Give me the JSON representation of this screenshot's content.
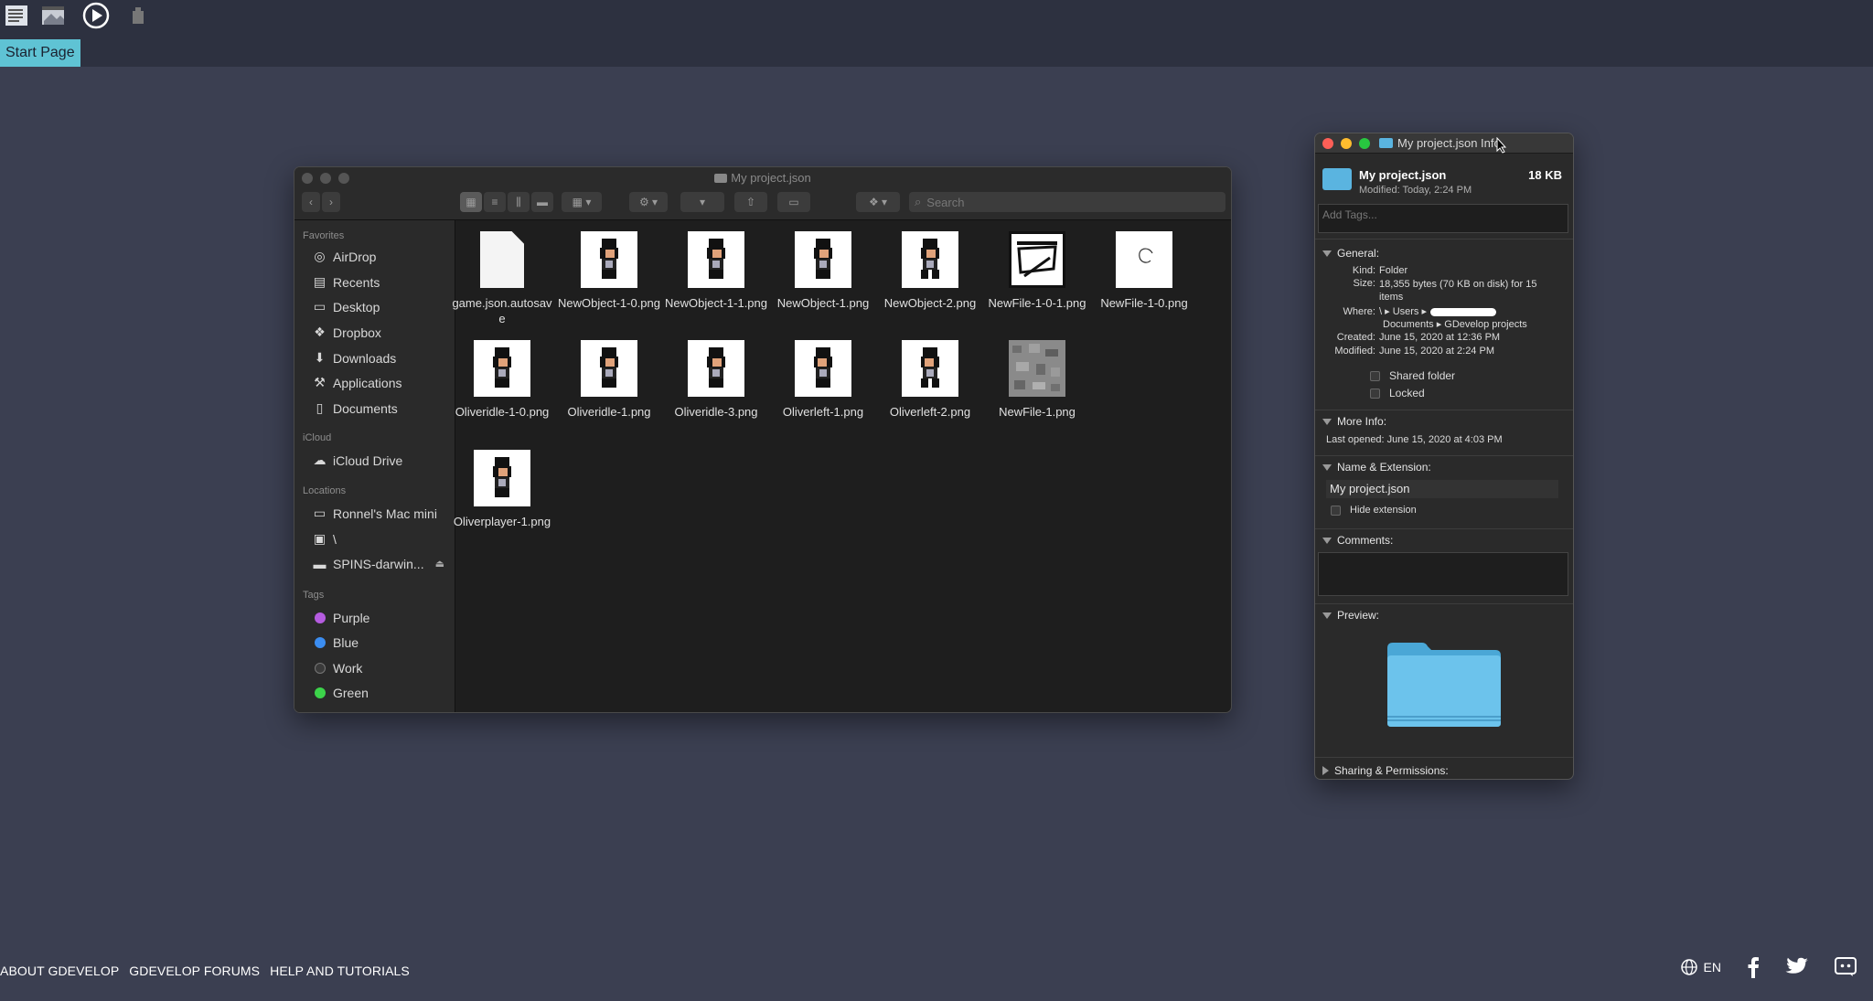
{
  "topbar": {
    "icons": [
      "project-manager-icon",
      "scene-editor-icon",
      "preview-play-icon",
      "export-icon"
    ],
    "start_tab": "Start Page"
  },
  "footer": {
    "links": [
      "ABOUT GDEVELOP",
      "GDEVELOP FORUMS",
      "HELP AND TUTORIALS"
    ],
    "language": "EN"
  },
  "finder": {
    "title": "My project.json",
    "search_placeholder": "Search",
    "sidebar": {
      "favorites_label": "Favorites",
      "favorites": [
        "AirDrop",
        "Recents",
        "Desktop",
        "Dropbox",
        "Downloads",
        "Applications",
        "Documents"
      ],
      "icloud_label": "iCloud",
      "icloud": [
        "iCloud Drive"
      ],
      "locations_label": "Locations",
      "locations": [
        "Ronnel's Mac mini",
        "\\",
        "SPINS-darwin..."
      ],
      "tags_label": "Tags",
      "tags": [
        {
          "name": "Purple",
          "color": "#b55ce0"
        },
        {
          "name": "Blue",
          "color": "#3b8df1"
        },
        {
          "name": "Work",
          "color": "#3a3a3a"
        },
        {
          "name": "Green",
          "color": "#3cd34a"
        }
      ]
    },
    "files": [
      {
        "name": "game.json.autosave",
        "kind": "document"
      },
      {
        "name": "NewObject-1-0.png",
        "kind": "sprite"
      },
      {
        "name": "NewObject-1-1.png",
        "kind": "sprite"
      },
      {
        "name": "NewObject-1.png",
        "kind": "sprite"
      },
      {
        "name": "NewObject-2.png",
        "kind": "sprite"
      },
      {
        "name": "NewFile-1-0-1.png",
        "kind": "drawing"
      },
      {
        "name": "NewFile-1-0.png",
        "kind": "scribble"
      },
      {
        "name": "Oliveridle-1-0.png",
        "kind": "sprite"
      },
      {
        "name": "Oliveridle-1.png",
        "kind": "sprite"
      },
      {
        "name": "Oliveridle-3.png",
        "kind": "sprite"
      },
      {
        "name": "Oliverleft-1.png",
        "kind": "sprite"
      },
      {
        "name": "Oliverleft-2.png",
        "kind": "sprite"
      },
      {
        "name": "NewFile-1.png",
        "kind": "texture"
      },
      {
        "name": "Oliverplayer-1.png",
        "kind": "sprite"
      }
    ]
  },
  "info": {
    "title": "My project.json Info",
    "name": "My project.json",
    "size": "18 KB",
    "modified": "Modified: Today, 2:24 PM",
    "tags_placeholder": "Add Tags...",
    "general_label": "General:",
    "kind_k": "Kind:",
    "kind_v": "Folder",
    "size_k": "Size:",
    "size_v": "18,355 bytes (70 KB on disk) for 15 items",
    "where_k": "Where:",
    "where_v1": "\\ ▸ Users ▸",
    "where_v2": "Documents ▸ GDevelop projects",
    "created_k": "Created:",
    "created_v": "June 15, 2020 at 12:36 PM",
    "modified_k": "Modified:",
    "modified_v": "June 15, 2020 at 2:24 PM",
    "shared_folder": "Shared folder",
    "locked": "Locked",
    "more_info_label": "More Info:",
    "last_opened": "Last opened: June 15, 2020 at 4:03 PM",
    "name_ext_label": "Name & Extension:",
    "name_value": "My project.json",
    "hide_extension": "Hide extension",
    "comments_label": "Comments:",
    "preview_label": "Preview:",
    "sharing_label": "Sharing & Permissions:"
  }
}
